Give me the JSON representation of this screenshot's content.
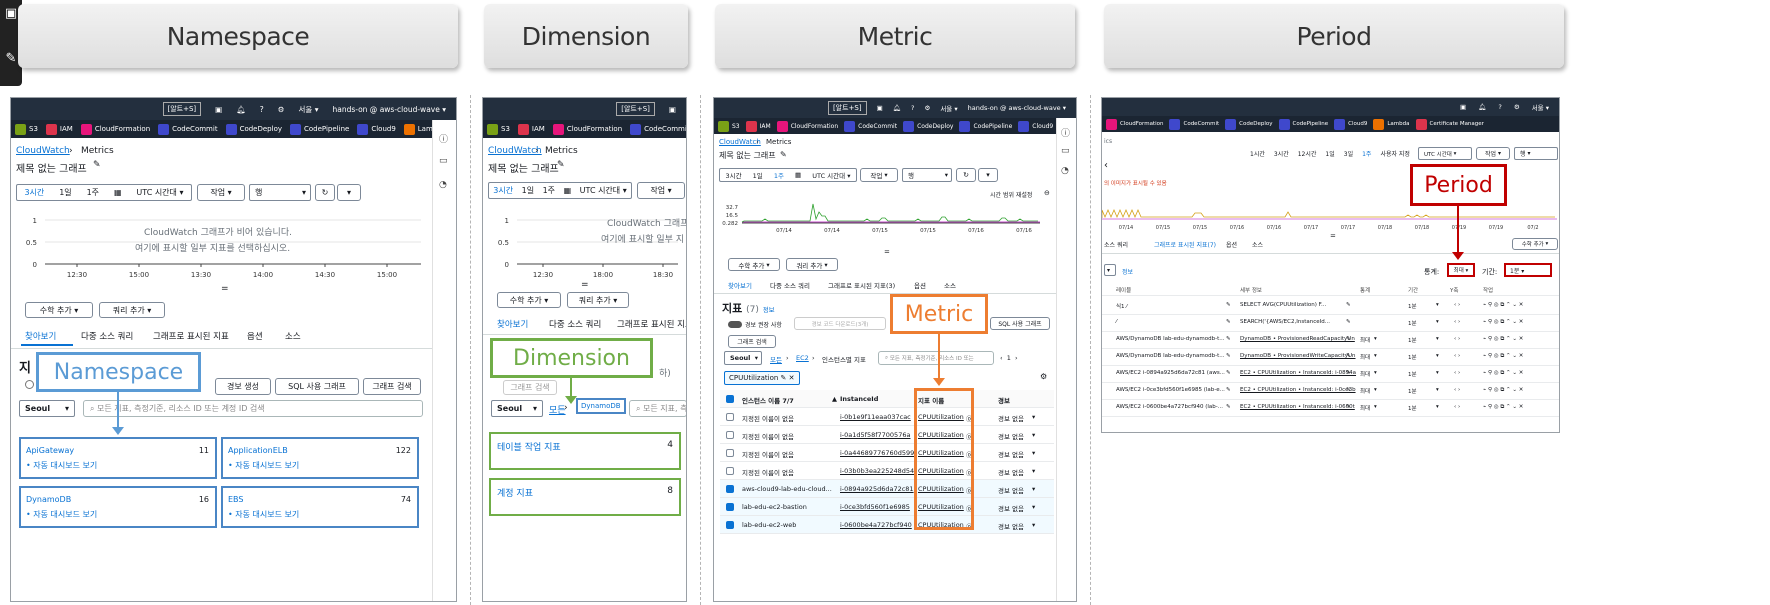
{
  "headers": [
    "Namespace",
    "Dimension",
    "Metric",
    "Period"
  ],
  "aws": {
    "shortcut": "[알트+S]",
    "region": "서울 ▾",
    "account": "hands-on @ aws-cloud-wave ▾",
    "services": [
      "S3",
      "IAM",
      "CloudFormation",
      "CodeCommit",
      "CodeDeploy",
      "CodePipeline",
      "Cloud9",
      "Lambda"
    ],
    "services4": [
      "CloudFormation",
      "CodeCommit",
      "CodeDeploy",
      "CodePipeline",
      "Cloud9",
      "Lambda",
      "Certificate Manager"
    ],
    "svc_colors": [
      "#7aa116",
      "#dd344c",
      "#e7157b",
      "#3f48cc",
      "#3f48cc",
      "#3f48cc",
      "#3f48cc",
      "#ed7100",
      "#dd344c"
    ],
    "breadcrumb_home": "CloudWatch",
    "breadcrumb_cur": "Metrics",
    "graph_title": "제목 없는 그래프",
    "time_3h": "3시간",
    "time_1d": "1일",
    "time_1w": "1주",
    "tz": "UTC 시간대",
    "actions": "작업",
    "line": "행",
    "add_math": "수학 추가",
    "add_query": "쿼리 추가",
    "empty1": "CloudWatch 그래프가 비어 있습니다.",
    "empty2": "여기에 표시할 일부 지표를 선택하십시오.",
    "tabs": [
      "찾아보기",
      "다중 소스 쿼리",
      "그래프로 표시된 지표",
      "옵션",
      "소스"
    ],
    "tabs3": [
      "찾아보기",
      "다중 소스 쿼리",
      "그래프로 표시된 지표(3)",
      "옵션",
      "소스"
    ],
    "seoul": "Seoul",
    "search_ph": "모든 지표, 측정기준, 리소스 ID 또는 계정 ID 검색",
    "search_ph2": "모든 지표, 측정기준",
    "alarm": "경보 생성",
    "sql": "SQL 사용 그래프",
    "graph_search": "그래프 검색",
    "all": "모든",
    "divider": "="
  },
  "p1": {
    "y": [
      "1",
      "0.5",
      "0"
    ],
    "x": [
      "12:30",
      "15:00",
      "13:30",
      "14:00",
      "14:30",
      "15:00"
    ],
    "title_frag": "지",
    "cards": [
      [
        "ApiGateway",
        "11"
      ],
      [
        "ApplicationELB",
        "122"
      ],
      [
        "DynamoDB",
        "16"
      ],
      [
        "EBS",
        "74"
      ]
    ],
    "auto": "• 자동 대시보드 보기",
    "callout": "Namespace"
  },
  "p2": {
    "y": [
      "1",
      "0.5",
      "0"
    ],
    "x": [
      "12:30",
      "18:00",
      "18:30"
    ],
    "empty1": "CloudWatch 그래프",
    "empty2": "여기에 표시할 일부 지",
    "chip": "DynamoDB",
    "frag": "하)",
    "rows": [
      [
        "테이블 작업 지표",
        "4"
      ],
      [
        "계정 지표",
        "8"
      ]
    ],
    "callout": "Dimension"
  },
  "p3": {
    "y": [
      "32.7",
      "16.5",
      "0.282"
    ],
    "x": [
      "07/14",
      "07/14",
      "07/15",
      "07/15",
      "07/16",
      "07/16"
    ],
    "timerange": "시간 범위 재설정",
    "metrics_title": "지표",
    "metrics_count": "(7)",
    "info": "정보",
    "alarm_toggle": "경보 권장 사항",
    "alarm_ph": "경보 코드 다운로드(3개)",
    "graph_search": "그래프 검색",
    "bc": [
      "모든",
      "EC2",
      "인스턴스별 지표"
    ],
    "search_ph": "모든 지표, 측정기준, 리소스 ID 또는",
    "page": "1",
    "filter": "CPUUtilization",
    "cols": [
      "인스턴스 이름 7/7",
      "InstanceId",
      "지표 이름",
      "경보"
    ],
    "rows": [
      {
        "name": "지정된 이름이 없음",
        "id": "i-0b1e9f11eaa037cac",
        "metric": "CPUUtilization",
        "alarm": "경보 없음",
        "on": false
      },
      {
        "name": "지정된 이름이 없음",
        "id": "i-0a1d5f58f7700576a",
        "metric": "CPUUtilization",
        "alarm": "경보 없음",
        "on": false
      },
      {
        "name": "지정된 이름이 없음",
        "id": "i-0a44689776760d599",
        "metric": "CPUUtilization",
        "alarm": "경보 없음",
        "on": false
      },
      {
        "name": "지정된 이름이 없음",
        "id": "i-03b0b3ea225248d54",
        "metric": "CPUUtilization",
        "alarm": "경보 없음",
        "on": false
      },
      {
        "name": "aws-cloud9-lab-edu-cloud...",
        "id": "i-0894a925d6da72c81",
        "metric": "CPUUtilization",
        "alarm": "경보 없음",
        "on": true
      },
      {
        "name": "lab-edu-ec2-bastion",
        "id": "i-0ce3bfd560f1e6985",
        "metric": "CPUUtilization",
        "alarm": "경보 없음",
        "on": true
      },
      {
        "name": "lab-edu-ec2-web",
        "id": "i-0600be4a727bcf940",
        "metric": "CPUUtilization",
        "alarm": "경보 없음",
        "on": true
      }
    ],
    "sql": "SQL 사용 그래프",
    "callout": "Metric"
  },
  "p4": {
    "times": [
      "1시간",
      "3시간",
      "12시간",
      "1일",
      "3일",
      "1주",
      "사용자 지정"
    ],
    "tz": "UTC 시간대",
    "actions": "작업",
    "line": "행",
    "frag_ics": "ics",
    "warn": "의 이미지가 표시될 수 있음",
    "x": [
      "07/14",
      "07/15",
      "07/15",
      "07/16",
      "07/16",
      "07/17",
      "07/17",
      "07/18",
      "07/18",
      "07/19",
      "07/19",
      "07/2"
    ],
    "tabs": [
      "소스 쿼리",
      "그래프로 표시된 지표(7)",
      "옵션",
      "소스"
    ],
    "add_math": "수학 추가",
    "info": "정보",
    "stat_label": "통계:",
    "stat_val": "최대 ▾",
    "period_label": "기간:",
    "period_val": "1분 ▾",
    "cols": [
      "레이블",
      "세부 정보",
      "통계",
      "기간",
      "Y축",
      "작업"
    ],
    "rows": [
      [
        "식1 ⁄",
        "SELECT AVG(CPUUtilization) F...",
        "",
        "1분"
      ],
      [
        "⁄",
        "SEARCH('{AWS/EC2,InstanceId...",
        "",
        "1분"
      ],
      [
        "AWS/DynamoDB lab-edu-dynamodb-t...",
        "DynamoDB • ProvisionedReadCapacityUn",
        "최대",
        "1분"
      ],
      [
        "AWS/DynamoDB lab-edu-dynamodb-t...",
        "DynamoDB • ProvisionedWriteCapacityUn",
        "최대",
        "1분"
      ],
      [
        "AWS/EC2 i-0894a925d6da72c81 (aws...",
        "EC2 • CPUUtilization • InstanceId: i-0894a",
        "최대",
        "1분"
      ],
      [
        "AWS/EC2 i-0ce3bfd560f1e6985 (lab-e...",
        "EC2 • CPUUtilization • InstanceId: i-0ce3b",
        "최대",
        "1분"
      ],
      [
        "AWS/EC2 i-0600be4a727bcf940 (lab-...",
        "EC2 • CPUUtilization • InstanceId: i-0600t",
        "최대",
        "1분"
      ]
    ],
    "callout": "Period"
  }
}
